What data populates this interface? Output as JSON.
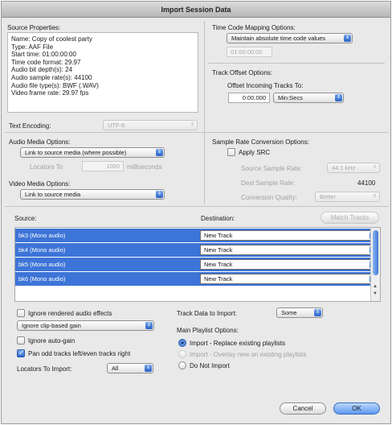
{
  "window": {
    "title": "Import Session Data"
  },
  "source_properties": {
    "label": "Source Properties:",
    "lines": [
      "Name: Copy of coolest party",
      "Type: AAF File",
      "Start time: 01:00:00:00",
      "Time code format: 29.97",
      "Audio bit depth(s): 24",
      "Audio sample rate(s): 44100",
      "Audio file type(s): BWF (.WAV)",
      "Video frame rate: 29.97 fps"
    ]
  },
  "text_encoding": {
    "label": "Text Encoding:",
    "value": "UTF-8"
  },
  "time_code_mapping": {
    "label": "Time Code Mapping Options:",
    "value": "Maintain absolute time code values",
    "time": "01:00:00:00"
  },
  "track_offset": {
    "label": "Track Offset Options:",
    "sublabel": "Offset Incoming Tracks To:",
    "value": "0:00.000",
    "units": "Min:Secs"
  },
  "audio_media": {
    "label": "Audio Media Options:",
    "value": "Link to source media (where possible)",
    "locators_label": "Locators To",
    "locators_value": "1000",
    "locators_units": "milliseconds"
  },
  "video_media": {
    "label": "Video Media Options:",
    "value": "Link to source media"
  },
  "src": {
    "label": "Sample Rate Conversion Options:",
    "apply_label": "Apply SRC",
    "source_rate_label": "Source Sample Rate:",
    "source_rate_value": "44.1 kHz",
    "dest_rate_label": "Dest Sample Rate:",
    "dest_rate_value": "44100",
    "quality_label": "Conversion Quality:",
    "quality_value": "Better"
  },
  "tracks": {
    "source_label": "Source:",
    "destination_label": "Destination:",
    "match_button": "Match Tracks",
    "rows": [
      {
        "source": "bk3 (Mono audio)",
        "destination": "New Track"
      },
      {
        "source": "bk4 (Mono audio)",
        "destination": "New Track"
      },
      {
        "source": "bk5 (Mono audio)",
        "destination": "New Track"
      },
      {
        "source": "bk6 (Mono audio)",
        "destination": "New Track"
      }
    ]
  },
  "options": {
    "ignore_rendered": "Ignore rendered audio effects",
    "clip_gain": "Ignore clip-based gain",
    "ignore_auto_gain": "Ignore auto-gain",
    "pan_odd": "Pan odd tracks left/even tracks right",
    "locators_label": "Locators To Import:",
    "locators_value": "All"
  },
  "track_data": {
    "label": "Track Data to Import:",
    "value": "Some"
  },
  "playlist": {
    "label": "Main Playlist Options:",
    "opt1": "Import - Replace existing playlists",
    "opt2": "Import - Overlay new on existing playlists",
    "opt3": "Do Not Import"
  },
  "buttons": {
    "cancel": "Cancel",
    "ok": "OK"
  }
}
